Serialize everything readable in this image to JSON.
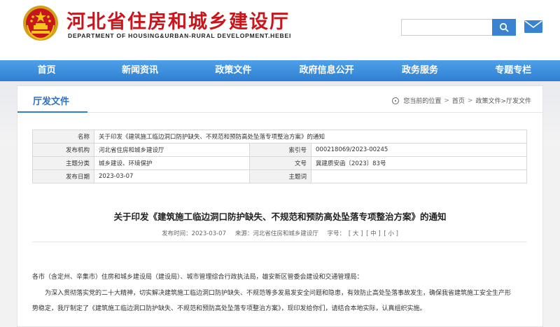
{
  "header": {
    "title": "河北省住房和城乡建设厅",
    "subtitle": "DEPARTMENT OF HOUSING&URBAN-RURAL DEVELOPMENT.HEBEI",
    "search_placeholder": "",
    "brand_color": "#c8161d",
    "accent_color": "#2f7fd2"
  },
  "nav": {
    "items": [
      "首页",
      "新闻资讯",
      "政策文件",
      "政府信息公开",
      "政务服务",
      "专题专栏"
    ]
  },
  "section": {
    "title": "厅发文件",
    "breadcrumb": {
      "prefix": "您当前的位置",
      "items": [
        "首页",
        "政策文件>厅发文件"
      ]
    }
  },
  "meta": {
    "name_label": "名称",
    "name_value": "关于印发《建筑施工临边洞口防护缺失、不规范和预防高处坠落专项整治方案》的通知",
    "org_label": "发布机构",
    "org_value": "河北省住房和城乡建设厅",
    "index_label": "索引号",
    "index_value": "000218069/2023-00245",
    "topic_label": "主题分类",
    "topic_value": "城乡建设、环境保护",
    "docno_label": "文号",
    "docno_value": "冀建质安函〔2023〕83号",
    "date_label": "发布日期",
    "date_value": "2023-03-07",
    "keywords_label": "主题词",
    "keywords_value": ""
  },
  "article": {
    "title": "关于印发《建筑施工临边洞口防护缺失、不规范和预防高处坠落专项整治方案》的通知",
    "date_text": "发布时间：2023-03-07",
    "source_text": "来源：河北省住房和城乡建设厅",
    "font_label": "字号：",
    "font_large": "[ 大 ]",
    "font_medium": "[ 中 ]",
    "font_small": "[ 小 ]",
    "para1": "各市（含定州、辛集市）住房和城乡建设局（建设局）、城市管理综合行政执法局，雄安新区管委会建设和交通管理局：",
    "para2": "为深入贯彻落实党的二十大精神，切实解决建筑施工临边洞口防护缺失、不规范等多发易发安全问题和隐患，有效防止高处坠落事故发生，确保我省建筑施工安全生产形",
    "para3": "势稳定，我厅制定了《建筑施工临边洞口防护缺失、不规范和预防高处坠落专项整治方案》，现印发给你们，请结合本地实际，认真组织实施。"
  }
}
